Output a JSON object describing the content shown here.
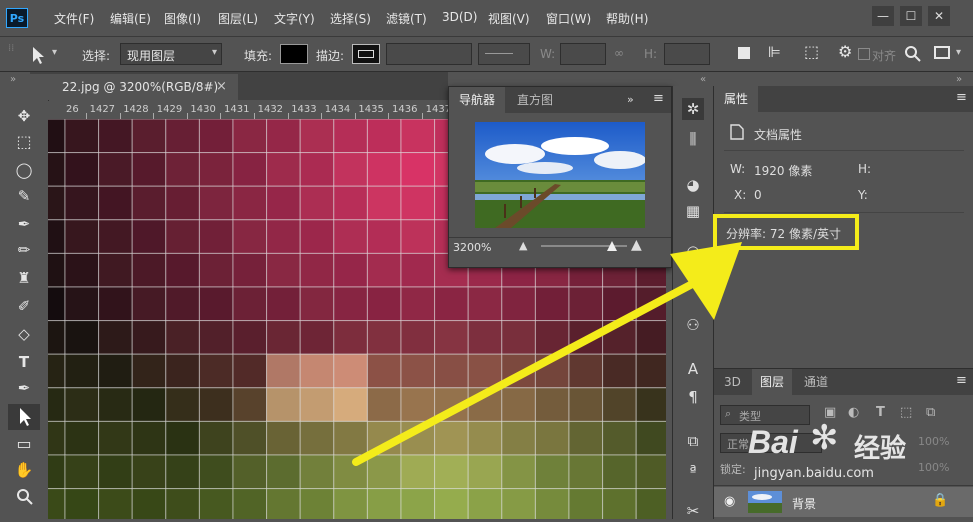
{
  "app": {
    "logo": "Ps"
  },
  "menu": [
    "文件(F)",
    "编辑(E)",
    "图像(I)",
    "图层(L)",
    "文字(Y)",
    "选择(S)",
    "滤镜(T)",
    "3D(D)",
    "视图(V)",
    "窗口(W)",
    "帮助(H)"
  ],
  "window_buttons": [
    "—",
    "☐",
    "✕"
  ],
  "options": {
    "select_label": "选择:",
    "select_value": "现用图层",
    "fill_label": "填充:",
    "stroke_label": "描边:",
    "w_label": "W:",
    "h_label": "H:",
    "align_label": "对齐"
  },
  "document_tab": {
    "title": "22.jpg @ 3200%(RGB/8#)",
    "close": "×"
  },
  "ruler": {
    "ticks": [
      "26",
      "1427",
      "1428",
      "1429",
      "1430",
      "1431",
      "1432",
      "1433",
      "1434",
      "1435",
      "1436",
      "1437"
    ]
  },
  "navigator": {
    "tabs": [
      "导航器",
      "直方图"
    ],
    "zoom": "3200%",
    "zoom_fraction": 0.82
  },
  "properties": {
    "title": "属性",
    "section": "文档属性",
    "w_label": "W:",
    "w_value": "1920 像素",
    "h_label": "H:",
    "x_label": "X:",
    "x_value": "0",
    "y_label": "Y:",
    "resolution": "分辨率: 72 像素/英寸"
  },
  "layers": {
    "tabs": [
      "3D",
      "图层",
      "通道"
    ],
    "filter_kind": "类型",
    "blend_mode": "正常",
    "opacity": "100%",
    "lock_label": "锁定:",
    "fill_value": "100%",
    "layer_name": "背景"
  },
  "watermark": {
    "brand_a": "Bai",
    "brand_b": "经验",
    "url": "jingyan.baidu.com"
  },
  "colors": {
    "highlight": "#f4ec1a",
    "arrow": "#f4ec1a",
    "ps_blue": "#31a8ff"
  }
}
